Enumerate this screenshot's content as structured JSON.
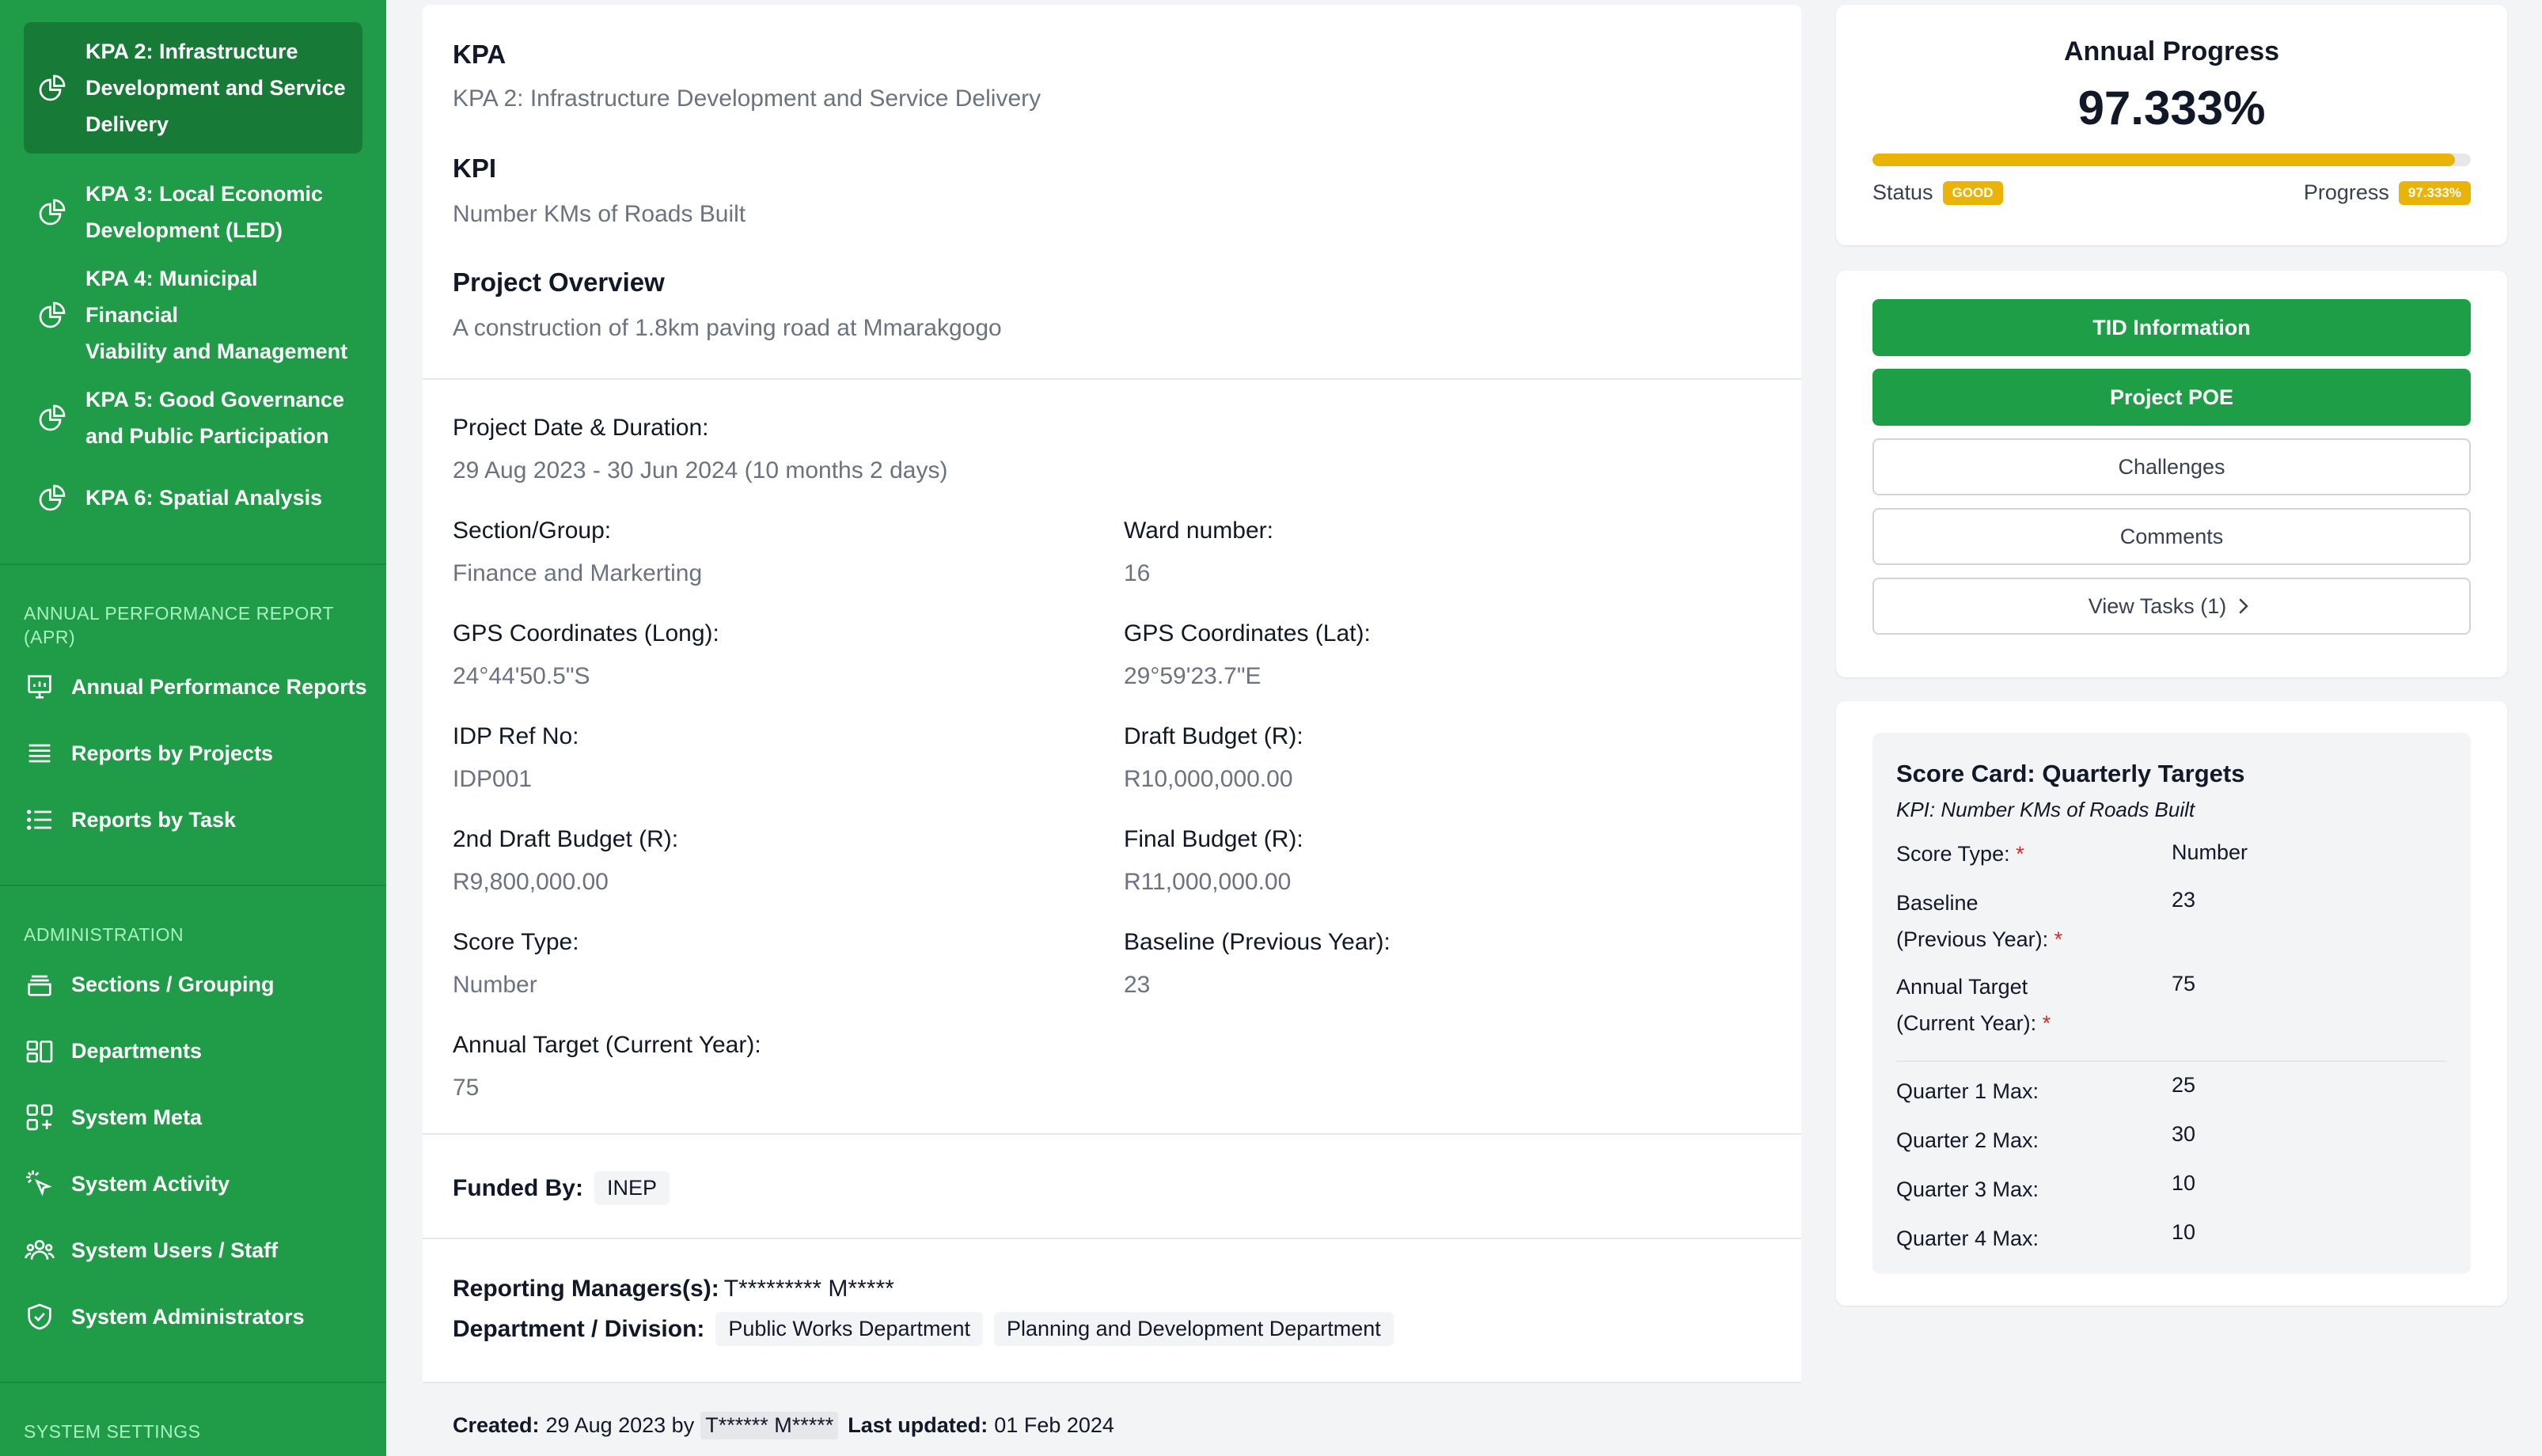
{
  "sidebar": {
    "kpa_items": [
      {
        "label_lines": [
          "KPA 2: Infrastructure",
          "Development and Service",
          "Delivery"
        ]
      },
      {
        "label_lines": [
          "KPA 3: Local Economic",
          "Development (LED)"
        ]
      },
      {
        "label_lines": [
          "KPA 4: Municipal Financial",
          "Viability and Management"
        ]
      },
      {
        "label_lines": [
          "KPA 5: Good Governance",
          "and Public Participation"
        ]
      },
      {
        "label_lines": [
          "KPA 6: Spatial Analysis"
        ]
      }
    ],
    "apr_header_lines": [
      "ANNUAL PERFORMANCE REPORT",
      "(APR)"
    ],
    "apr_items": [
      "Annual Performance Reports",
      "Reports by Projects",
      "Reports by Task"
    ],
    "admin_header": "ADMINISTRATION",
    "admin_items": [
      "Sections / Grouping",
      "Departments",
      "System Meta",
      "System Activity",
      "System Users / Staff",
      "System Administrators"
    ],
    "settings_header": "SYSTEM SETTINGS"
  },
  "main": {
    "kpa_label": "KPA",
    "kpa_value": "KPA 2: Infrastructure Development and Service Delivery",
    "kpi_label": "KPI",
    "kpi_value": "Number KMs of Roads Built",
    "overview_label": "Project Overview",
    "overview_value": "A construction of 1.8km paving road at Mmarakgogo",
    "date_label": "Project Date & Duration:",
    "date_value": "29 Aug 2023 - 30 Jun 2024 (10 months 2 days)",
    "section_label": "Section/Group:",
    "section_value": "Finance and Markerting",
    "ward_label": "Ward number:",
    "ward_value": "16",
    "gps_long_label": "GPS Coordinates (Long):",
    "gps_long_value": "24°44'50.5\"S",
    "gps_lat_label": "GPS Coordinates (Lat):",
    "gps_lat_value": "29°59'23.7\"E",
    "idp_label": "IDP Ref No:",
    "idp_value": "IDP001",
    "draft_label": "Draft Budget (R):",
    "draft_value": "R10,000,000.00",
    "draft2_label": "2nd Draft Budget (R):",
    "draft2_value": "R9,800,000.00",
    "final_label": "Final Budget (R):",
    "final_value": "R11,000,000.00",
    "score_type_label": "Score Type:",
    "score_type_value": "Number",
    "baseline_label": "Baseline (Previous Year):",
    "baseline_value": "23",
    "annual_target_label": "Annual Target (Current Year):",
    "annual_target_value": "75",
    "funded_label": "Funded By:",
    "funded_value": "INEP",
    "managers_label": "Reporting Managers(s):",
    "managers_value": "T********* M*****",
    "department_label": "Department / Division:",
    "departments": [
      "Public Works Department",
      "Planning and Development Department"
    ],
    "created_label": "Created:",
    "created_value": "29 Aug 2023 by",
    "created_by": "T****** M*****",
    "updated_label": "Last updated:",
    "updated_value": "01 Feb 2024"
  },
  "progress": {
    "title": "Annual Progress",
    "value_text": "97.333%",
    "fraction": 0.97333,
    "status_label": "Status",
    "status_badge": "GOOD",
    "progress_label": "Progress",
    "progress_badge": "97.333%",
    "bar_color": "#eab308"
  },
  "actions": {
    "tid": "TID Information",
    "poe": "Project POE",
    "challenges": "Challenges",
    "comments": "Comments",
    "tasks": "View Tasks (1)"
  },
  "scorecard": {
    "title": "Score Card: Quarterly Targets",
    "subtitle": "KPI: Number KMs of Roads Built",
    "score_type_label": "Score Type:",
    "score_type_value": "Number",
    "baseline_label_lines": [
      "Baseline",
      "(Previous Year):"
    ],
    "baseline_value": "23",
    "target_label_lines": [
      "Annual Target",
      "(Current Year):"
    ],
    "target_value": "75",
    "required_mark": "*",
    "quarters": [
      {
        "label": "Quarter 1 Max:",
        "value": "25"
      },
      {
        "label": "Quarter 2 Max:",
        "value": "30"
      },
      {
        "label": "Quarter 3 Max:",
        "value": "10"
      },
      {
        "label": "Quarter 4 Max:",
        "value": "10"
      }
    ]
  },
  "colors": {
    "sidebar": "#209b48",
    "sidebar_active": "#177a37",
    "primary_button": "#1e9e46",
    "badge": "#eab308"
  }
}
